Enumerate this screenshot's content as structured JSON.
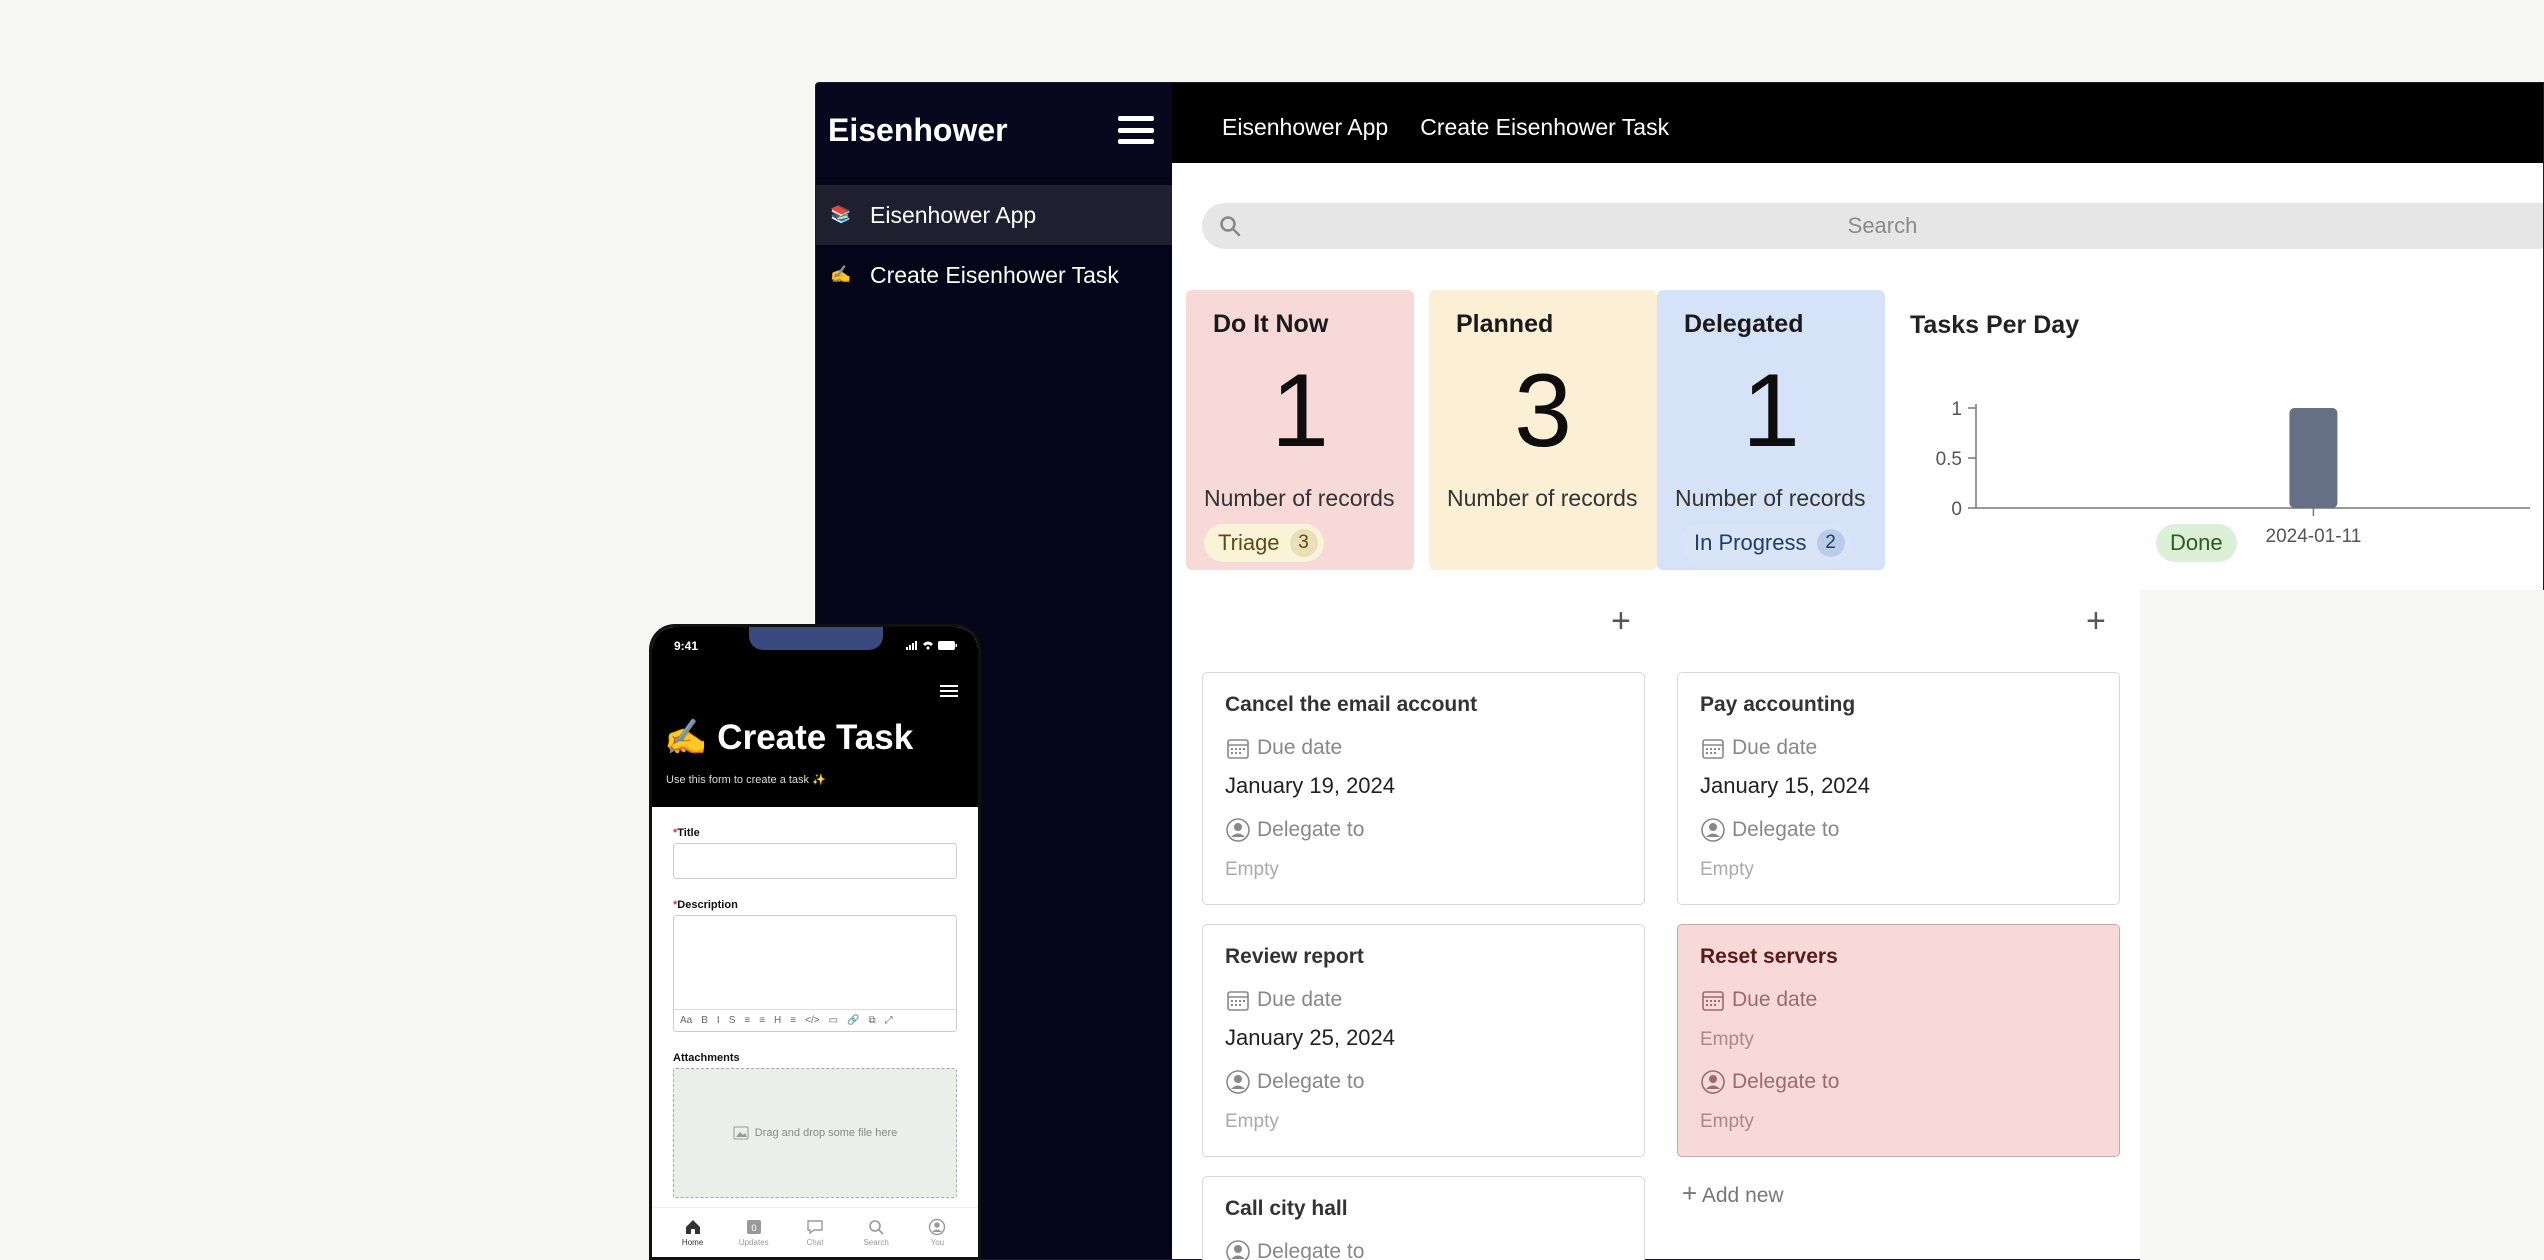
{
  "sidebar": {
    "title": "Eisenhower",
    "items": [
      {
        "emoji": "📚",
        "label": "Eisenhower App"
      },
      {
        "emoji": "✍️",
        "label": "Create Eisenhower Task"
      }
    ]
  },
  "tabs": [
    {
      "label": "Eisenhower App"
    },
    {
      "label": "Create Eisenhower Task"
    }
  ],
  "search": {
    "placeholder": "Search"
  },
  "stats": [
    {
      "title": "Do It Now",
      "value": "1",
      "caption": "Number of records",
      "color": "#f7d9d8"
    },
    {
      "title": "Planned",
      "value": "3",
      "caption": "Number of records",
      "color": "#fbefd5"
    },
    {
      "title": "Delegated",
      "value": "1",
      "caption": "Number of records",
      "color": "#d6e2f7"
    }
  ],
  "chart_data": {
    "type": "bar",
    "title": "Tasks Per Day",
    "categories": [
      "2024-01-11"
    ],
    "values": [
      1
    ],
    "yticks": [
      "0",
      "0.5",
      "1"
    ],
    "ylim": [
      0,
      1
    ],
    "color": "#667085"
  },
  "board": {
    "columns": [
      {
        "name": "Triage",
        "count": "3",
        "pill_bg": "#fbf3d8",
        "count_bg": "#e9dfb8",
        "text": "#5e4b16"
      },
      {
        "name": "In Progress",
        "count": "2",
        "pill_bg": "#d9e5f7",
        "count_bg": "#b9ccea",
        "text": "#1f3c6b"
      },
      {
        "name": "Done",
        "pill_bg": "#dcefd7",
        "text": "#2b5a23"
      }
    ],
    "add_new": "Add new",
    "due_label": "Due date",
    "delegate_label": "Delegate to",
    "empty": "Empty",
    "cards": {
      "triage": [
        {
          "title": "Cancel the email account",
          "due": "January 19, 2024",
          "delegate": "Empty"
        },
        {
          "title": "Review report",
          "due": "January 25, 2024",
          "delegate": "Empty"
        },
        {
          "title": "Call city hall"
        }
      ],
      "in_progress": [
        {
          "title": "Pay accounting",
          "due": "January 15, 2024",
          "delegate": "Empty"
        },
        {
          "title": "Reset servers",
          "due": "Empty",
          "delegate": "Empty"
        }
      ]
    }
  },
  "phone": {
    "time": "9:41",
    "title": "✍️ Create Task",
    "subtitle": "Use this form to create a task ✨",
    "fields": {
      "title_label": "Title",
      "description_label": "Description",
      "attachments_label": "Attachments",
      "drop_text": "Drag and drop some file here"
    },
    "toolbar": [
      "Aa",
      "B",
      "I",
      "S",
      "≡",
      "≡",
      "H",
      "≡",
      "</>",
      "▭",
      "🔗",
      "⧉",
      "⤢"
    ],
    "nav": [
      {
        "label": "Home",
        "icon": "home-icon"
      },
      {
        "label": "Updates",
        "icon": "updates-icon"
      },
      {
        "label": "Chat",
        "icon": "chat-icon"
      },
      {
        "label": "Search",
        "icon": "search-icon"
      },
      {
        "label": "You",
        "icon": "user-icon"
      }
    ]
  }
}
